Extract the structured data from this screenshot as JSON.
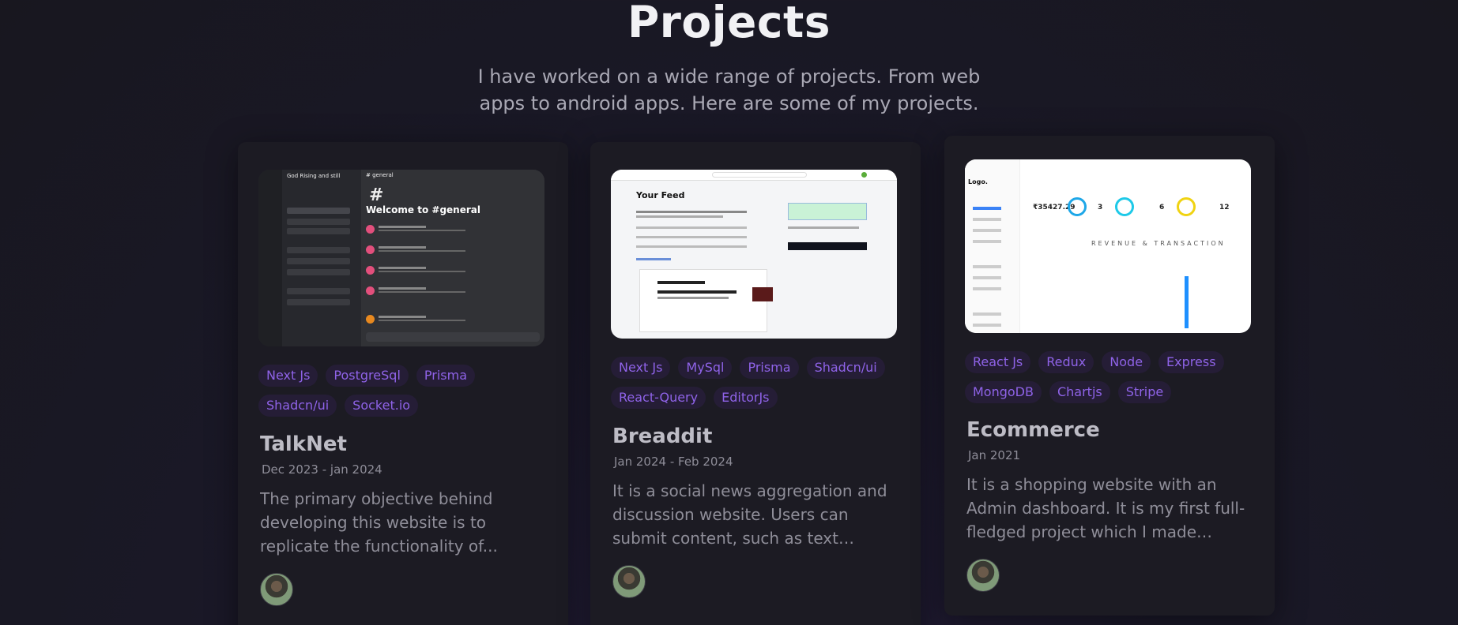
{
  "header": {
    "title": "Projects",
    "subtitle": "I have worked on a wide range of projects. From web apps to android apps. Here are some of my projects."
  },
  "projects": [
    {
      "name": "TalkNet",
      "date": "Dec 2023 - jan 2024",
      "description": "The primary objective behind developing this website is to replicate the functionality of...",
      "tags": [
        "Next Js",
        "PostgreSql",
        "Prisma",
        "Shadcn/ui",
        "Socket.io"
      ],
      "preview": {
        "server_name": "God Rising and still",
        "channel": "# general",
        "welcome": "Welcome to #general"
      }
    },
    {
      "name": "Breaddit",
      "date": "Jan 2024 - Feb 2024",
      "description": "It is a social news aggregation and discussion website. Users can submit content, such as text posts,...",
      "tags": [
        "Next Js",
        "MySql",
        "Prisma",
        "Shadcn/ui",
        "React-Query",
        "EditorJs"
      ],
      "preview": {
        "heading": "Your Feed"
      }
    },
    {
      "name": "Ecommerce",
      "date": "Jan 2021",
      "description": "It is a shopping website with an Admin dashboard. It is my first full-fledged project which I made whil...",
      "tags": [
        "React Js",
        "Redux",
        "Node",
        "Express",
        "MongoDB",
        "Chartjs",
        "Stripe"
      ],
      "preview": {
        "logo": "Logo.",
        "revenue": "₹35427.29",
        "stat2": "3",
        "stat3": "6",
        "stat4": "12",
        "section": "REVENUE & TRANSACTION"
      }
    }
  ],
  "colors": {
    "tag_text": "#8f63e8",
    "tag_bg": "#251d36",
    "card_bg": "#1c1b23"
  }
}
